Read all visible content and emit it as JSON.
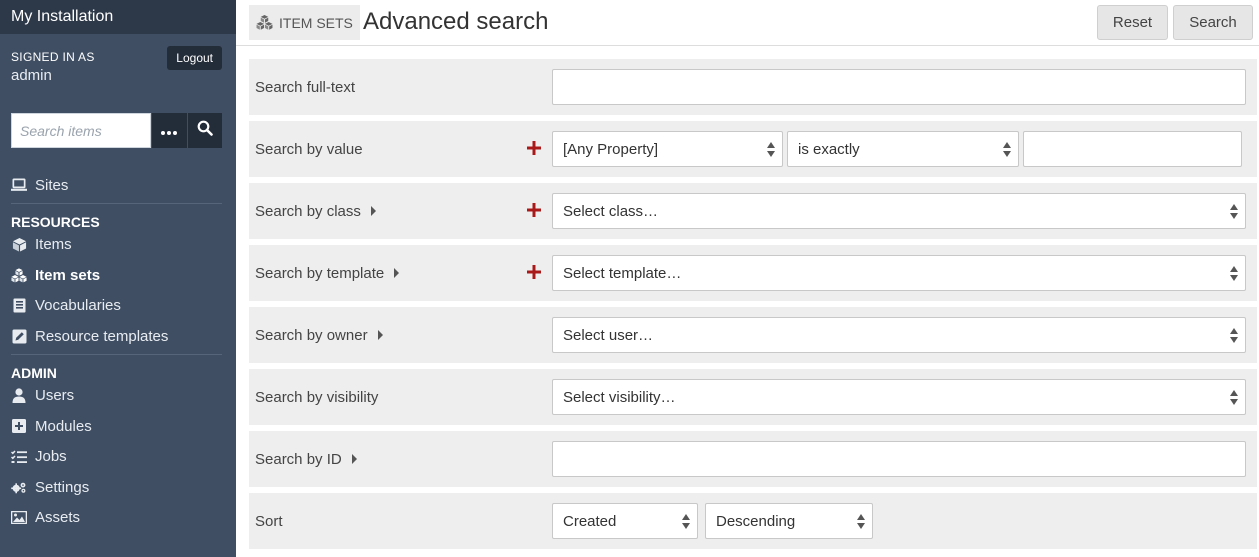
{
  "sidebar": {
    "install_name": "My Installation",
    "signed_in_label": "SIGNED IN AS",
    "username": "admin",
    "logout_label": "Logout",
    "search_placeholder": "Search items",
    "more_icon": "ellipsis-icon",
    "search_icon": "search-icon",
    "sites_label": "Sites",
    "resources_heading": "RESOURCES",
    "resources": [
      "Items",
      "Item sets",
      "Vocabularies",
      "Resource templates"
    ],
    "admin_heading": "ADMIN",
    "admin": [
      "Users",
      "Modules",
      "Jobs",
      "Settings",
      "Assets"
    ],
    "active_item": "Item sets"
  },
  "header": {
    "breadcrumb": "ITEM SETS",
    "title": "Advanced search",
    "reset_label": "Reset",
    "search_label": "Search"
  },
  "form": {
    "fulltext_label": "Search full-text",
    "fulltext_value": "",
    "value_label": "Search by value",
    "value_property": "[Any Property]",
    "value_operator": "is exactly",
    "value_text": "",
    "class_label": "Search by class",
    "class_select": "Select class…",
    "template_label": "Search by template",
    "template_select": "Select template…",
    "owner_label": "Search by owner",
    "owner_select": "Select user…",
    "visibility_label": "Search by visibility",
    "visibility_select": "Select visibility…",
    "id_label": "Search by ID",
    "id_value": "",
    "sort_label": "Sort",
    "sort_by": "Created",
    "sort_order": "Descending"
  },
  "colors": {
    "sidebar_bg": "#3f4e63",
    "sidebar_top": "#2d3849",
    "accent_plus": "#a91919"
  }
}
